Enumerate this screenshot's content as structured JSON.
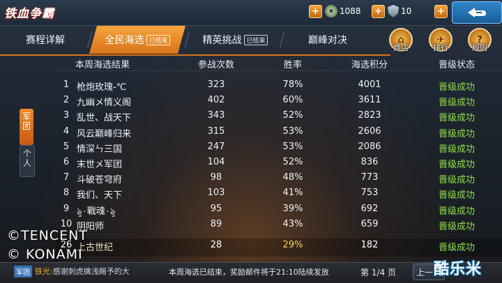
{
  "header": {
    "title": "铁血争霸",
    "resource1": "1088",
    "resource2": "10"
  },
  "tabs": [
    {
      "label": "赛程详解",
      "tag": ""
    },
    {
      "label": "全民海选",
      "tag": "已结束"
    },
    {
      "label": "精英挑战",
      "tag": "已结束"
    },
    {
      "label": "巅峰对决",
      "tag": ""
    }
  ],
  "side_icons": [
    {
      "label": "商店"
    },
    {
      "label": "排行"
    },
    {
      "label": "规则"
    }
  ],
  "side_tabs": {
    "active": "军团",
    "inactive": "个人"
  },
  "table": {
    "headers": [
      "本周海选结果",
      "参战次数",
      "胜率",
      "海选积分",
      "晋级状态"
    ],
    "rows": [
      {
        "rank": "1",
        "name": "枪炮玫瑰-℃",
        "battles": "323",
        "winrate": "78%",
        "score": "4001",
        "status": "晋级成功"
      },
      {
        "rank": "2",
        "name": "九幽メ情义阁",
        "battles": "402",
        "winrate": "60%",
        "score": "3611",
        "status": "晋级成功"
      },
      {
        "rank": "3",
        "name": "乱世、战天下",
        "battles": "343",
        "winrate": "52%",
        "score": "2823",
        "status": "晋级成功"
      },
      {
        "rank": "4",
        "name": "风云巅峰归来",
        "battles": "315",
        "winrate": "53%",
        "score": "2606",
        "status": "晋级成功"
      },
      {
        "rank": "5",
        "name": "情深ㄣ三国",
        "battles": "247",
        "winrate": "53%",
        "score": "2086",
        "status": "晋级成功"
      },
      {
        "rank": "6",
        "name": "末世メ军团",
        "battles": "104",
        "winrate": "52%",
        "score": "836",
        "status": "晋级成功"
      },
      {
        "rank": "7",
        "name": "斗破苍穹府",
        "battles": "98",
        "winrate": "48%",
        "score": "773",
        "status": "晋级成功"
      },
      {
        "rank": "8",
        "name": "我们、天下",
        "battles": "103",
        "winrate": "41%",
        "score": "753",
        "status": "晋级成功"
      },
      {
        "rank": "9",
        "name": "ৡ۰戰魂۰ৡ",
        "battles": "95",
        "winrate": "39%",
        "score": "692",
        "status": "晋级成功"
      },
      {
        "rank": "10",
        "name": "阴阳师",
        "battles": "89",
        "winrate": "43%",
        "score": "659",
        "status": "晋级成功"
      }
    ],
    "self_row": {
      "rank": "26",
      "name": "上古世纪",
      "battles": "28",
      "winrate": "29%",
      "score": "182",
      "status": "晋级成功"
    }
  },
  "watermark": {
    "line1": "©TENCENT",
    "line2": "© KONAMI"
  },
  "bottom": {
    "chat_tag": "军团",
    "chat_name": "铁光:",
    "chat_text": "感谢刺虎擒浅赐予的大",
    "notice": "本周海选已结束，奖励邮件将于21:10陆续发放",
    "page": "第 1/4 页",
    "page_button": "上一页"
  },
  "brand": "酷乐米",
  "colors": {
    "accent": "#e0821f",
    "status_green": "#8fe04a",
    "highlight_yellow": "#f7d44a"
  }
}
